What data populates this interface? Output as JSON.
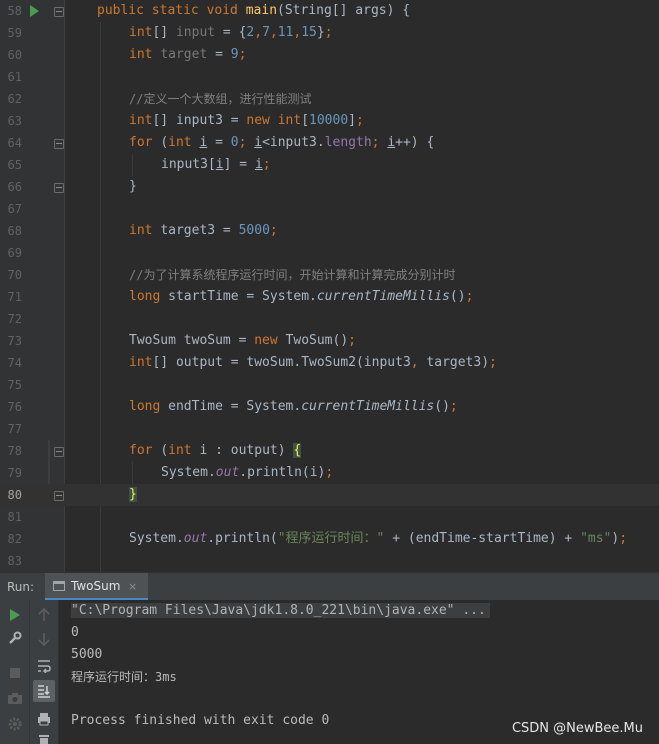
{
  "editor": {
    "lines": [
      {
        "num": "58",
        "current": false
      },
      {
        "num": "59",
        "current": false
      },
      {
        "num": "60",
        "current": false
      },
      {
        "num": "61",
        "current": false
      },
      {
        "num": "62",
        "current": false
      },
      {
        "num": "63",
        "current": false
      },
      {
        "num": "64",
        "current": false
      },
      {
        "num": "65",
        "current": false
      },
      {
        "num": "66",
        "current": false
      },
      {
        "num": "67",
        "current": false
      },
      {
        "num": "68",
        "current": false
      },
      {
        "num": "69",
        "current": false
      },
      {
        "num": "70",
        "current": false
      },
      {
        "num": "71",
        "current": false
      },
      {
        "num": "72",
        "current": false
      },
      {
        "num": "73",
        "current": false
      },
      {
        "num": "74",
        "current": false
      },
      {
        "num": "75",
        "current": false
      },
      {
        "num": "76",
        "current": false
      },
      {
        "num": "77",
        "current": false
      },
      {
        "num": "78",
        "current": false
      },
      {
        "num": "79",
        "current": false
      },
      {
        "num": "80",
        "current": true
      },
      {
        "num": "81",
        "current": false
      },
      {
        "num": "82",
        "current": false
      },
      {
        "num": "83",
        "current": false
      }
    ],
    "code": {
      "l58": {
        "t1": "public static void ",
        "t2": "main",
        "t3": "(String[] args) {"
      },
      "l59": {
        "t1": "int",
        "t2": "[] ",
        "t3": "input",
        "t4": " = {",
        "t5": "2",
        "t6": ",",
        "t7": "7",
        "t8": ",",
        "t9": "11",
        "t10": ",",
        "t11": "15",
        "t12": "}",
        "t13": ";"
      },
      "l60": {
        "t1": "int ",
        "t2": "target",
        "t3": " = ",
        "t4": "9",
        "t5": ";"
      },
      "l62": {
        "t1": "//定义一个大数组，进行性能测试"
      },
      "l63": {
        "t1": "int",
        "t2": "[] input3 = ",
        "t3": "new int",
        "t4": "[",
        "t5": "10000",
        "t6": "]",
        "t7": ";"
      },
      "l64": {
        "t1": "for ",
        "t2": "(",
        "t3": "int ",
        "t4": "i",
        "t5": " = ",
        "t6": "0",
        "t7": "; ",
        "t8": "i",
        "t9": "<input3.",
        "t10": "length",
        "t11": "; ",
        "t12": "i",
        "t13": "++) {"
      },
      "l65": {
        "t1": "input3[",
        "t2": "i",
        "t3": "] = ",
        "t4": "i",
        "t5": ";"
      },
      "l66": {
        "t1": "}"
      },
      "l68": {
        "t1": "int ",
        "t2": "target3 = ",
        "t3": "5000",
        "t4": ";"
      },
      "l70": {
        "t1": "//为了计算系统程序运行时间，开始计算和计算完成分别计时"
      },
      "l71": {
        "t1": "long ",
        "t2": "startTime = System.",
        "t3": "currentTimeMillis",
        "t4": "()",
        "t5": ";"
      },
      "l73": {
        "t1": "TwoSum twoSum = ",
        "t2": "new ",
        "t3": "TwoSum()",
        "t4": ";"
      },
      "l74": {
        "t1": "int",
        "t2": "[] output = twoSum.TwoSum2(input3",
        "t3": ", ",
        "t4": "target3)",
        "t5": ";"
      },
      "l76": {
        "t1": "long ",
        "t2": "endTime = System.",
        "t3": "currentTimeMillis",
        "t4": "()",
        "t5": ";"
      },
      "l78": {
        "t1": "for ",
        "t2": "(",
        "t3": "int ",
        "t4": "i : output) ",
        "t5": "{"
      },
      "l79": {
        "t1": "System.",
        "t2": "out",
        "t3": ".println(i)",
        "t4": ";"
      },
      "l80": {
        "t1": "}"
      },
      "l82": {
        "t1": "System.",
        "t2": "out",
        "t3": ".println(",
        "t4": "\"程序运行时间：\"",
        "t5": " + (endTime-startTime) + ",
        "t6": "\"ms\"",
        "t7": ")",
        "t8": ";"
      }
    }
  },
  "run_panel": {
    "label": "Run:",
    "tab_label": "TwoSum",
    "tab_close": "×",
    "console": {
      "command": "\"C:\\Program Files\\Java\\jdk1.8.0_221\\bin\\java.exe\" ...",
      "out1": "0",
      "out2": "5000",
      "out3": "程序运行时间：3ms",
      "exit": "Process finished with exit code 0"
    }
  },
  "watermark": "CSDN @NewBee.Mu",
  "colors": {
    "background": "#2b2b2b",
    "keyword": "#cc7832",
    "number": "#6897bb",
    "string": "#6a8759",
    "comment": "#808080",
    "method": "#ffc66d",
    "field": "#9876aa"
  }
}
